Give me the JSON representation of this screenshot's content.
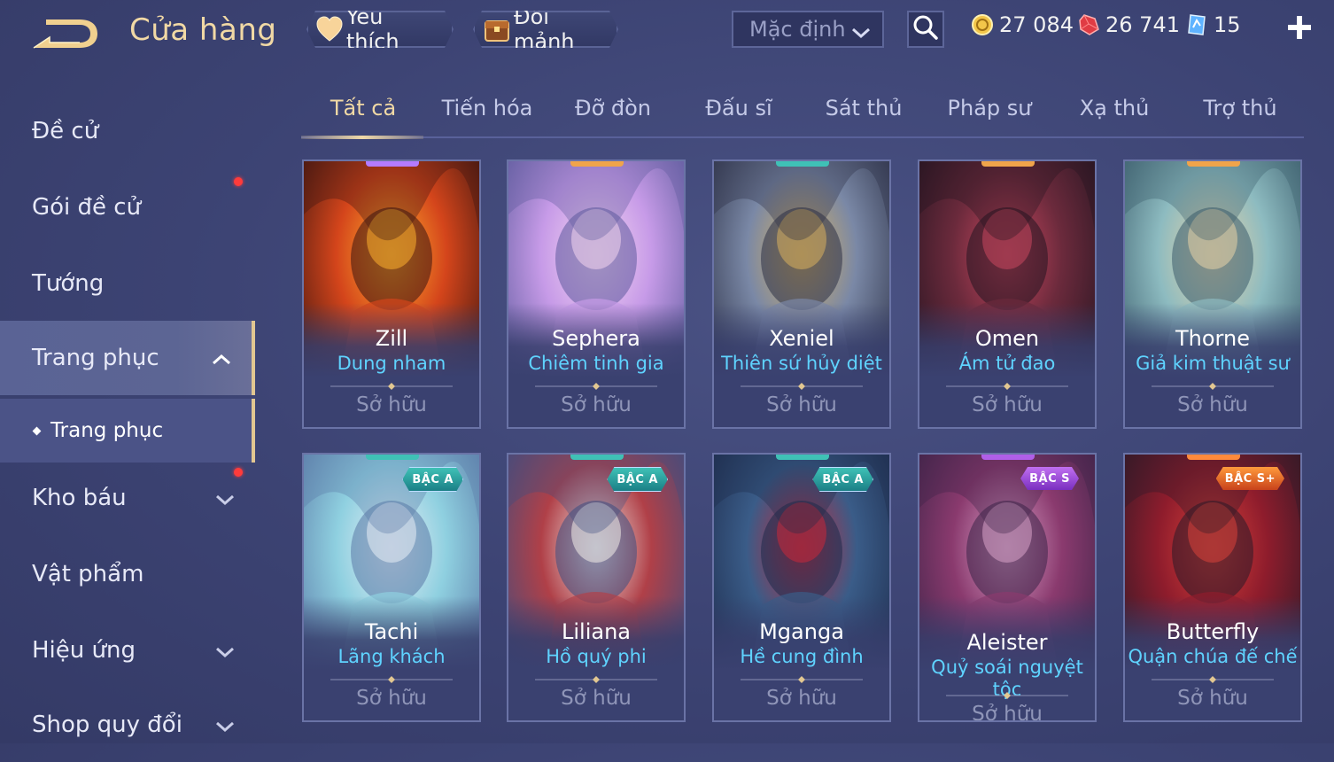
{
  "header": {
    "title": "Cửa hàng",
    "favorites_label": "Yêu thích",
    "exchange_label": "Đổi mảnh",
    "sort_value": "Mặc định",
    "currencies": [
      {
        "name": "gold",
        "value": "27 084",
        "color": "#f3c64a"
      },
      {
        "name": "voucher",
        "value": "26 741",
        "color": "#ff5a5a"
      },
      {
        "name": "diamond",
        "value": "15",
        "color": "#7fc9ff"
      }
    ]
  },
  "sidebar": {
    "items": [
      {
        "label": "Đề cử"
      },
      {
        "label": "Gói đề cử"
      },
      {
        "label": "Tướng"
      },
      {
        "label": "Trang phục"
      },
      {
        "label": "Trang phục"
      },
      {
        "label": "Kho báu"
      },
      {
        "label": "Vật phẩm"
      },
      {
        "label": "Hiệu ứng"
      },
      {
        "label": "Shop quy đổi"
      }
    ]
  },
  "tabs": [
    {
      "label": "Tất cả"
    },
    {
      "label": "Tiến hóa"
    },
    {
      "label": "Đỡ đòn"
    },
    {
      "label": "Đấu sĩ"
    },
    {
      "label": "Sát thủ"
    },
    {
      "label": "Pháp sư"
    },
    {
      "label": "Xạ thủ"
    },
    {
      "label": "Trợ thủ"
    }
  ],
  "cards": [
    {
      "hero": "Zill",
      "skin": "Dung nham",
      "status": "Sở hữu",
      "tier": "",
      "tier_color": "#b47bff",
      "palette": [
        "#3a1410",
        "#d4451b",
        "#ffb12e"
      ]
    },
    {
      "hero": "Sephera",
      "skin": "Chiêm tinh gia",
      "status": "Sở hữu",
      "tier": "",
      "tier_color": "#f0a44a",
      "palette": [
        "#5c5a9c",
        "#c79be8",
        "#f4d6ef"
      ]
    },
    {
      "hero": "Xeniel",
      "skin": "Thiên sứ hủy diệt",
      "status": "Sở hữu",
      "tier": "",
      "tier_color": "#3fc1b6",
      "palette": [
        "#2b2f45",
        "#7a88a6",
        "#d8b15e"
      ]
    },
    {
      "hero": "Omen",
      "skin": "Ám tử đao",
      "status": "Sở hữu",
      "tier": "",
      "tier_color": "#f0a44a",
      "palette": [
        "#221420",
        "#6b2a3c",
        "#c9475f"
      ]
    },
    {
      "hero": "Thorne",
      "skin": "Giả kim thuật sư",
      "status": "Sở hữu",
      "tier": "",
      "tier_color": "#f0a44a",
      "palette": [
        "#3a5b6b",
        "#8dbbc0",
        "#e8d3a8"
      ]
    },
    {
      "hero": "Tachi",
      "skin": "Lãng khách",
      "status": "Sở hữu",
      "tier": "BẬC A",
      "tier_color": "#3fc1b6",
      "palette": [
        "#5a78a6",
        "#8fd0e0",
        "#e8eef5"
      ]
    },
    {
      "hero": "Liliana",
      "skin": "Hồ quý phi",
      "status": "Sở hữu",
      "tier": "BẬC A",
      "tier_color": "#3fc1b6",
      "palette": [
        "#3d4d80",
        "#b04048",
        "#f2ece8"
      ]
    },
    {
      "hero": "Mganga",
      "skin": "Hề cung đình",
      "status": "Sở hữu",
      "tier": "BẬC A",
      "tier_color": "#3fc1b6",
      "palette": [
        "#1d2a4a",
        "#3a5c88",
        "#c8283a"
      ]
    },
    {
      "hero": "Aleister",
      "skin": "Quỷ soái nguyệt tộc",
      "status": "Sở hữu",
      "tier": "BẬC S",
      "tier_color": "#b05fe8",
      "palette": [
        "#3b2347",
        "#8a3a6e",
        "#d9a2c9"
      ]
    },
    {
      "hero": "Butterfly",
      "skin": "Quận chúa đế chế",
      "status": "Sở hữu",
      "tier": "BẬC S+",
      "tier_color": "#ff8a3c",
      "palette": [
        "#2a1a28",
        "#8e1c2c",
        "#d8413a"
      ]
    }
  ]
}
